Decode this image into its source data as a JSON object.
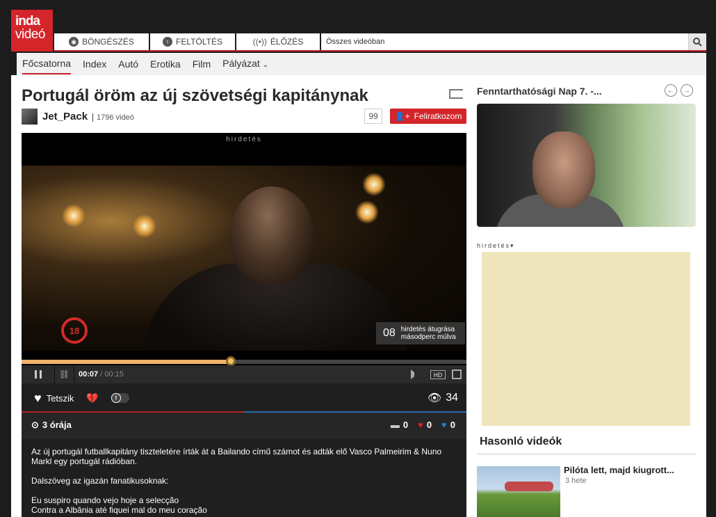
{
  "logo": {
    "line1": "inda",
    "line2": "videó"
  },
  "nav": {
    "browse": "BÖNGÉSZÉS",
    "upload": "FELTÖLTÉS",
    "live": "ÉLŐZÉS",
    "search_placeholder": "Összes videóban"
  },
  "subnav": [
    "Főcsatorna",
    "Index",
    "Autó",
    "Erotika",
    "Film",
    "Pályázat"
  ],
  "video": {
    "title": "Portugál öröm az új szövetségi kapitánynak",
    "channel": "Jet_Pack",
    "video_count": "1796 videó",
    "subscriber_count": "99",
    "subscribe_label": "Feliratkozom",
    "ad_label": "hirdetés",
    "age_rating": "18",
    "skip_seconds": "08",
    "skip_text_1": "hirdetés átugrása",
    "skip_text_2": "másodperc múlva",
    "current_time": "00:07",
    "duration": "00:15",
    "progress_fraction": 0.47,
    "hd_label": "HD"
  },
  "actions": {
    "like_label": "Tetszik",
    "views": "34",
    "uploaded": "3 órája",
    "comments": "0",
    "likes": "0",
    "dislikes": "0",
    "like_ratio": 0.5
  },
  "description": {
    "para1": "Az új portugál futballkapitány tiszteletére írták át a Bailando című számot és adták elő Vasco Palmeirim & Nuno Markl egy portugál rádióban.",
    "para2": "Dalszöveg az igazán fanatikusoknak:",
    "line1": "Eu suspiro quando vejo hoje a selecção",
    "line2": "Contra a Albânia até fiquei mal do meu coração"
  },
  "sidebar": {
    "featured_title": "Fenntarthatósági Nap 7. -...",
    "ad_label": "hirdetés",
    "related_heading": "Hasonló videók",
    "related": [
      {
        "title": "Pilóta lett, majd kiugrott...",
        "time": "3 hete"
      }
    ]
  },
  "colors": {
    "brand_red": "#d4252b",
    "ad_bg": "#efe6bd",
    "progress": "#f2b26a"
  }
}
